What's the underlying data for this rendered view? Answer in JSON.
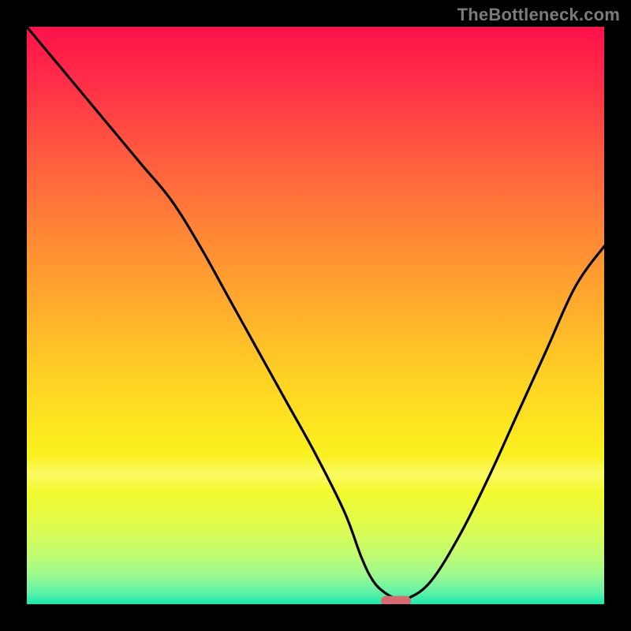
{
  "watermark": "TheBottleneck.com",
  "colors": {
    "frame": "#000000",
    "curve": "#000000",
    "marker": "#d86a6f",
    "gradient_top": "#ff1249",
    "gradient_bottom": "#18e8ae"
  },
  "chart_data": {
    "type": "line",
    "title": "",
    "xlabel": "",
    "ylabel": "",
    "xlim": [
      0,
      100
    ],
    "ylim": [
      0,
      100
    ],
    "grid": false,
    "legend": false,
    "series": [
      {
        "name": "bottleneck-curve",
        "x": [
          0,
          5,
          10,
          15,
          20,
          25,
          30,
          35,
          40,
          45,
          50,
          55,
          58,
          60,
          62,
          64,
          66,
          70,
          75,
          80,
          85,
          90,
          95,
          100
        ],
        "y": [
          100,
          94,
          88,
          82,
          76,
          70,
          62,
          53,
          44,
          35,
          26,
          16,
          8,
          4,
          2,
          1,
          1,
          4,
          12,
          22,
          33,
          44,
          55,
          62
        ]
      }
    ],
    "annotations": [
      {
        "name": "optimum-marker",
        "x": 64,
        "y": 0.6,
        "shape": "pill",
        "color": "#d86a6f"
      }
    ],
    "background_gradient": {
      "direction": "vertical",
      "stops": [
        {
          "pos": 0.0,
          "color": "#ff1249"
        },
        {
          "pos": 0.22,
          "color": "#ff5a3f"
        },
        {
          "pos": 0.48,
          "color": "#ffab2d"
        },
        {
          "pos": 0.72,
          "color": "#fced1f"
        },
        {
          "pos": 0.91,
          "color": "#c4fc6e"
        },
        {
          "pos": 1.0,
          "color": "#18e8ae"
        }
      ]
    }
  }
}
